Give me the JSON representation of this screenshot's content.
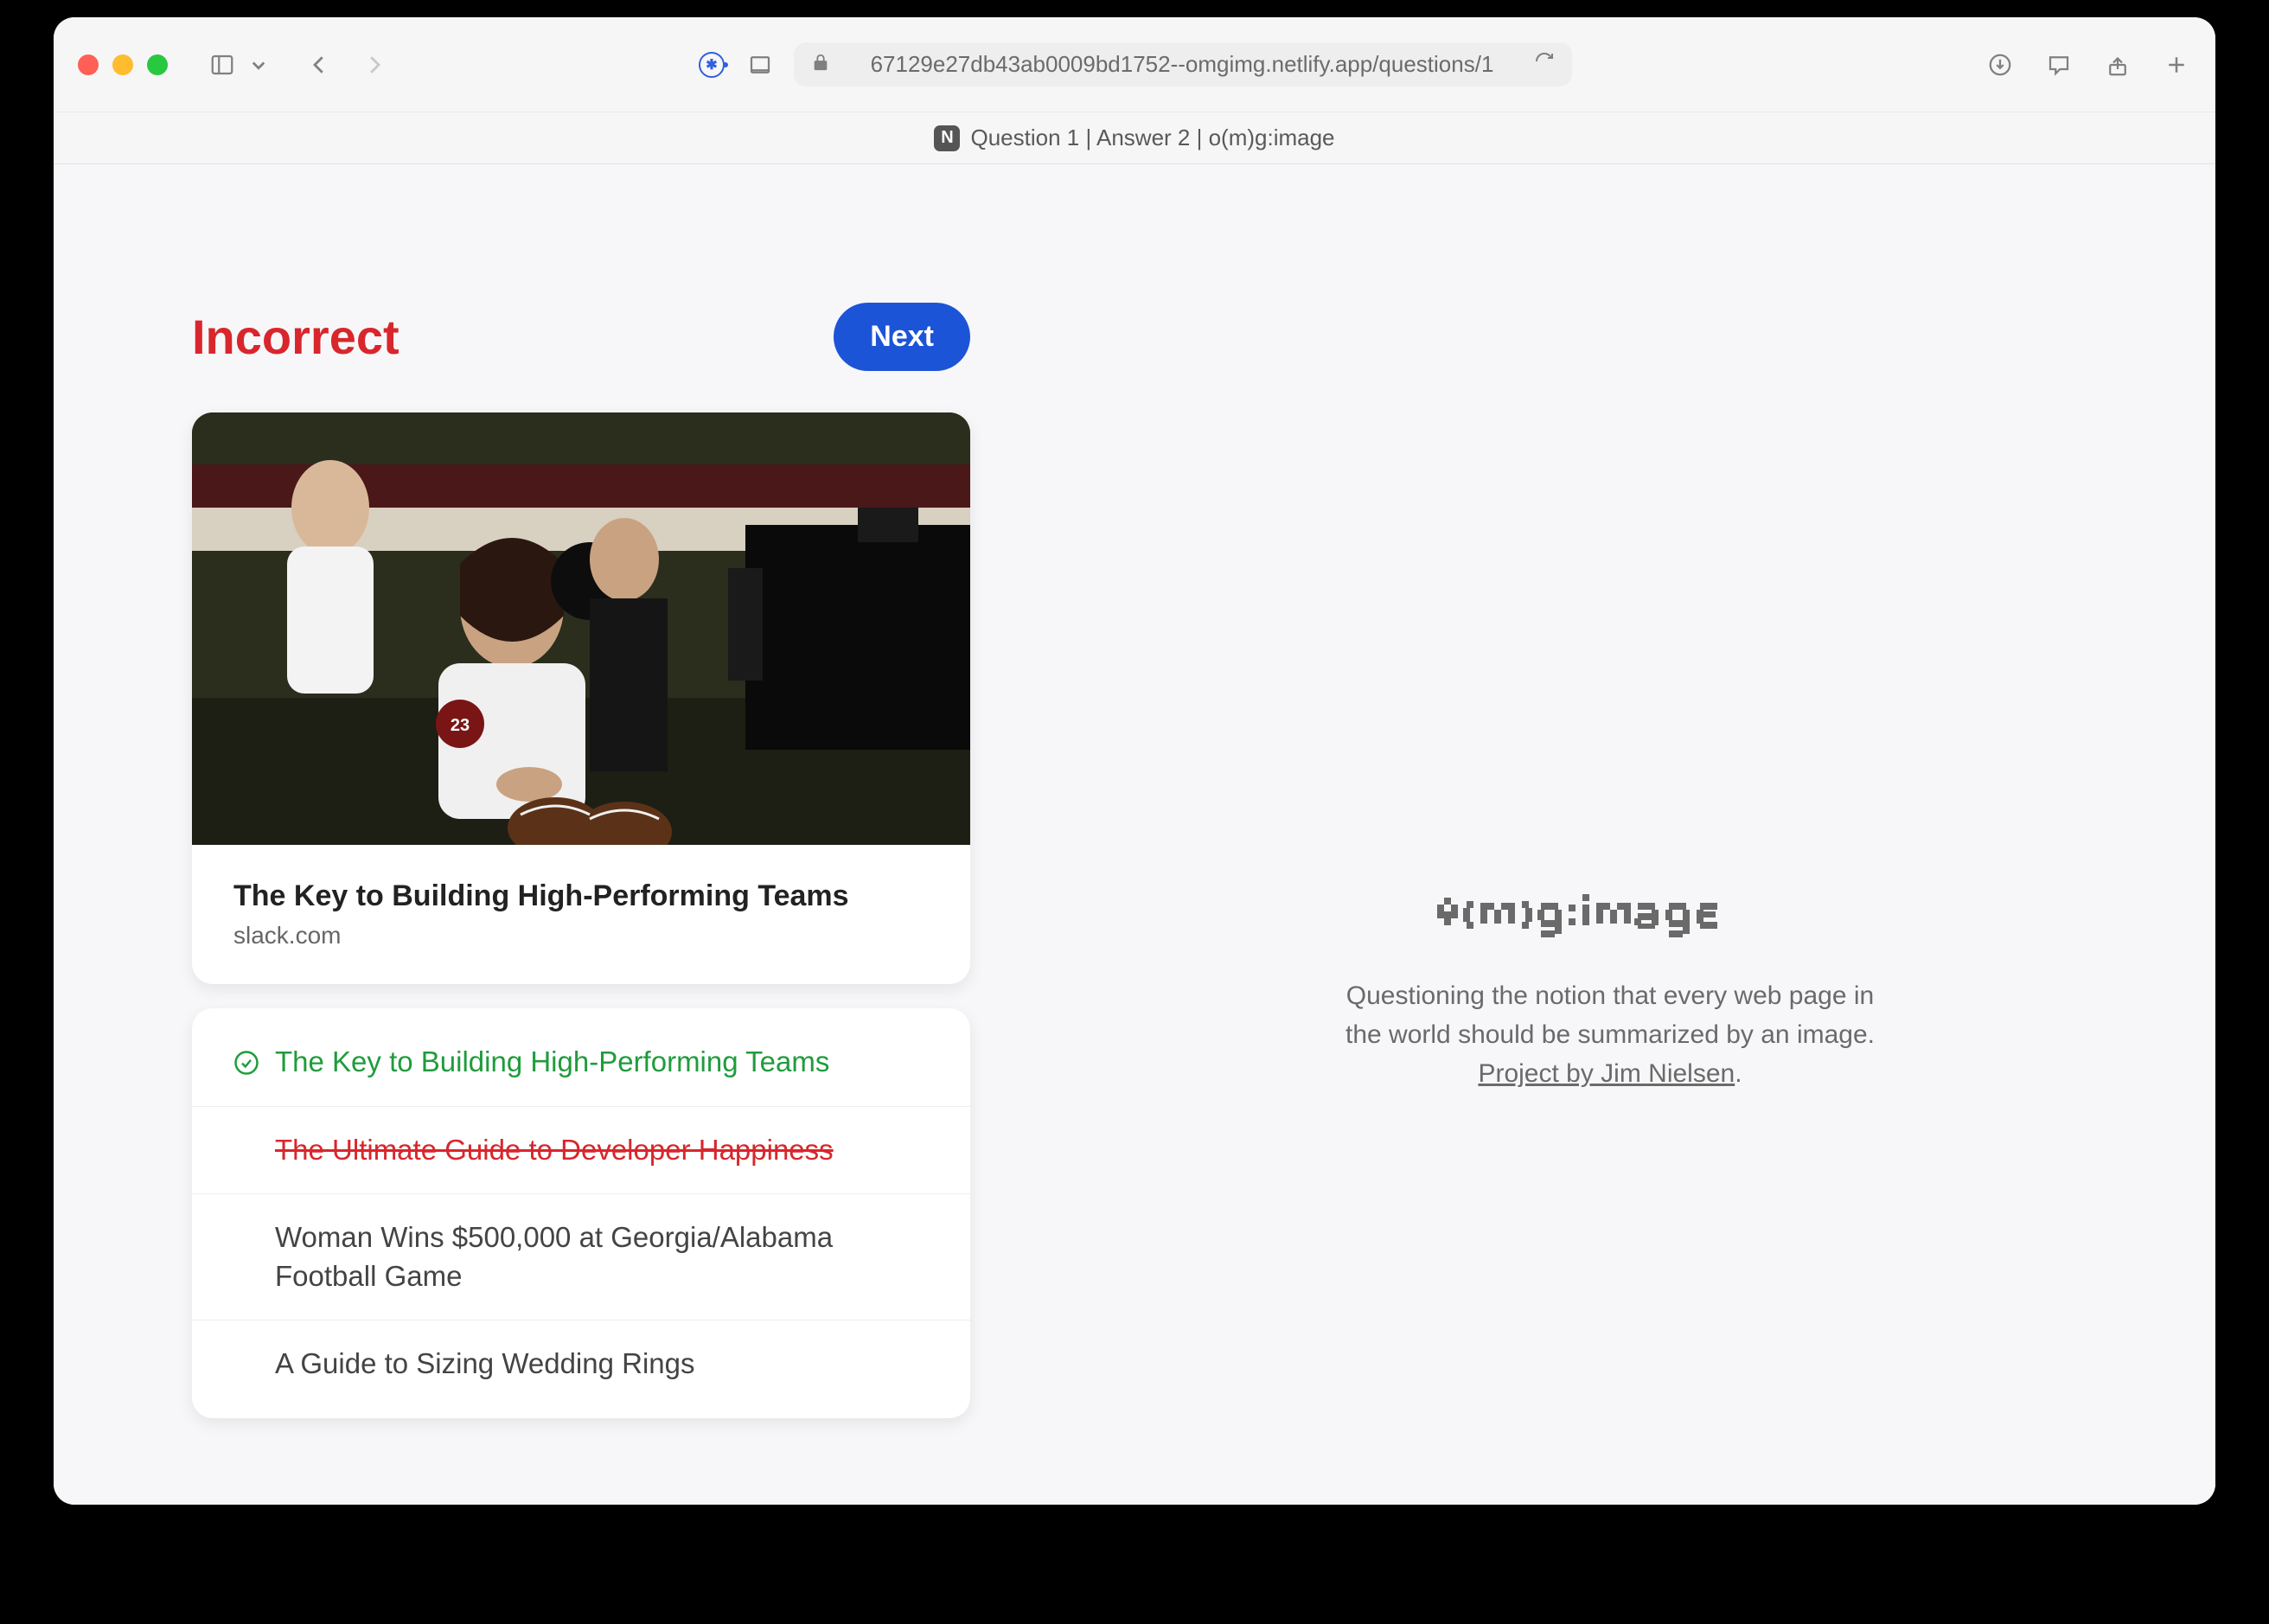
{
  "browser": {
    "url": "67129e27db43ab0009bd1752--omgimg.netlify.app/questions/1",
    "tabTitle": "Question 1 | Answer 2 | o(m)g:image"
  },
  "result": {
    "status": "Incorrect",
    "nextLabel": "Next"
  },
  "card": {
    "title": "The Key to Building High-Performing Teams",
    "domain": "slack.com"
  },
  "answers": [
    {
      "text": "The Key to Building High-Performing Teams",
      "state": "correct"
    },
    {
      "text": "The Ultimate Guide to Developer Happiness",
      "state": "wrong"
    },
    {
      "text": "Woman Wins $500,000 at Georgia/Alabama Football Game",
      "state": "neutral"
    },
    {
      "text": "A Guide to Sizing Wedding Rings",
      "state": "neutral"
    }
  ],
  "sidebar": {
    "logoText": "o(m)g:image",
    "tagline1": "Questioning the notion that every web page in the world should be summarized by an image.",
    "projectLink": "Project by Jim Nielsen",
    "period": "."
  },
  "colors": {
    "incorrect": "#d8262c",
    "correct": "#1f9c3c",
    "primary": "#1c54d8"
  }
}
